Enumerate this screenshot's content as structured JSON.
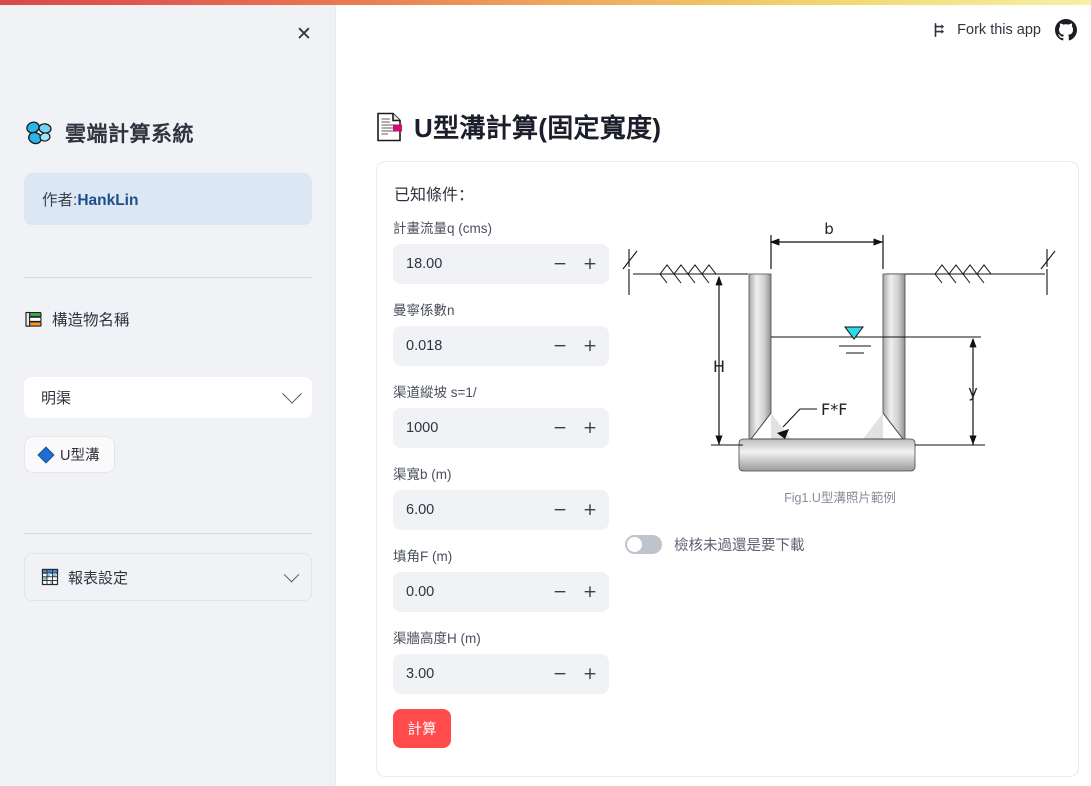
{
  "topbar": {
    "gradient_from": "#d94a4a",
    "gradient_to": "#f7f0a6"
  },
  "sidebar": {
    "close_label": "✕",
    "brand_title": "雲端計算系統",
    "brand_logo_icon": "butterfly-logo-icon",
    "author_prefix": "作者:",
    "author_name": "HankLin",
    "section_title": "構造物名稱",
    "section_icon": "books-icon",
    "structure_select_value": "明渠",
    "structure_select_options": [
      "明渠"
    ],
    "type_button_label": "U型溝",
    "type_button_icon": "blue-diamond-icon",
    "expander_label": "報表設定",
    "expander_icon": "spreadsheet-grid-icon"
  },
  "header": {
    "fork_label": "Fork this app",
    "fork_icon": "fork-icon",
    "github_icon": "github-icon"
  },
  "page": {
    "title": "U型溝計算(固定寬度)",
    "title_icon": "document-page-icon"
  },
  "card": {
    "heading": "已知條件：",
    "fields": [
      {
        "label": "計畫流量q (cms)",
        "value": "18.00",
        "name": "flow-rate-q"
      },
      {
        "label": "曼寧係數n",
        "value": "0.018",
        "name": "manning-n"
      },
      {
        "label": "渠道縱坡 s=1/",
        "value": "1000",
        "name": "slope-s"
      },
      {
        "label": "渠寬b (m)",
        "value": "6.00",
        "name": "channel-width-b"
      },
      {
        "label": "填角F (m)",
        "value": "0.00",
        "name": "fillet-f"
      },
      {
        "label": "渠牆高度H (m)",
        "value": "3.00",
        "name": "wall-height-h"
      }
    ],
    "step_minus": "−",
    "step_plus": "+",
    "submit_label": "計算",
    "submit_color": "#ff4b4b",
    "figure_caption": "Fig1.U型溝照片範例",
    "toggle_label": "檢核未過還是要下載",
    "toggle_state": "off",
    "diagram": {
      "labels": {
        "width": "b",
        "wall_height": "H",
        "water_depth": "y",
        "fillet": "F*F"
      },
      "water_surface_symbol": "water-level-triangle"
    }
  }
}
